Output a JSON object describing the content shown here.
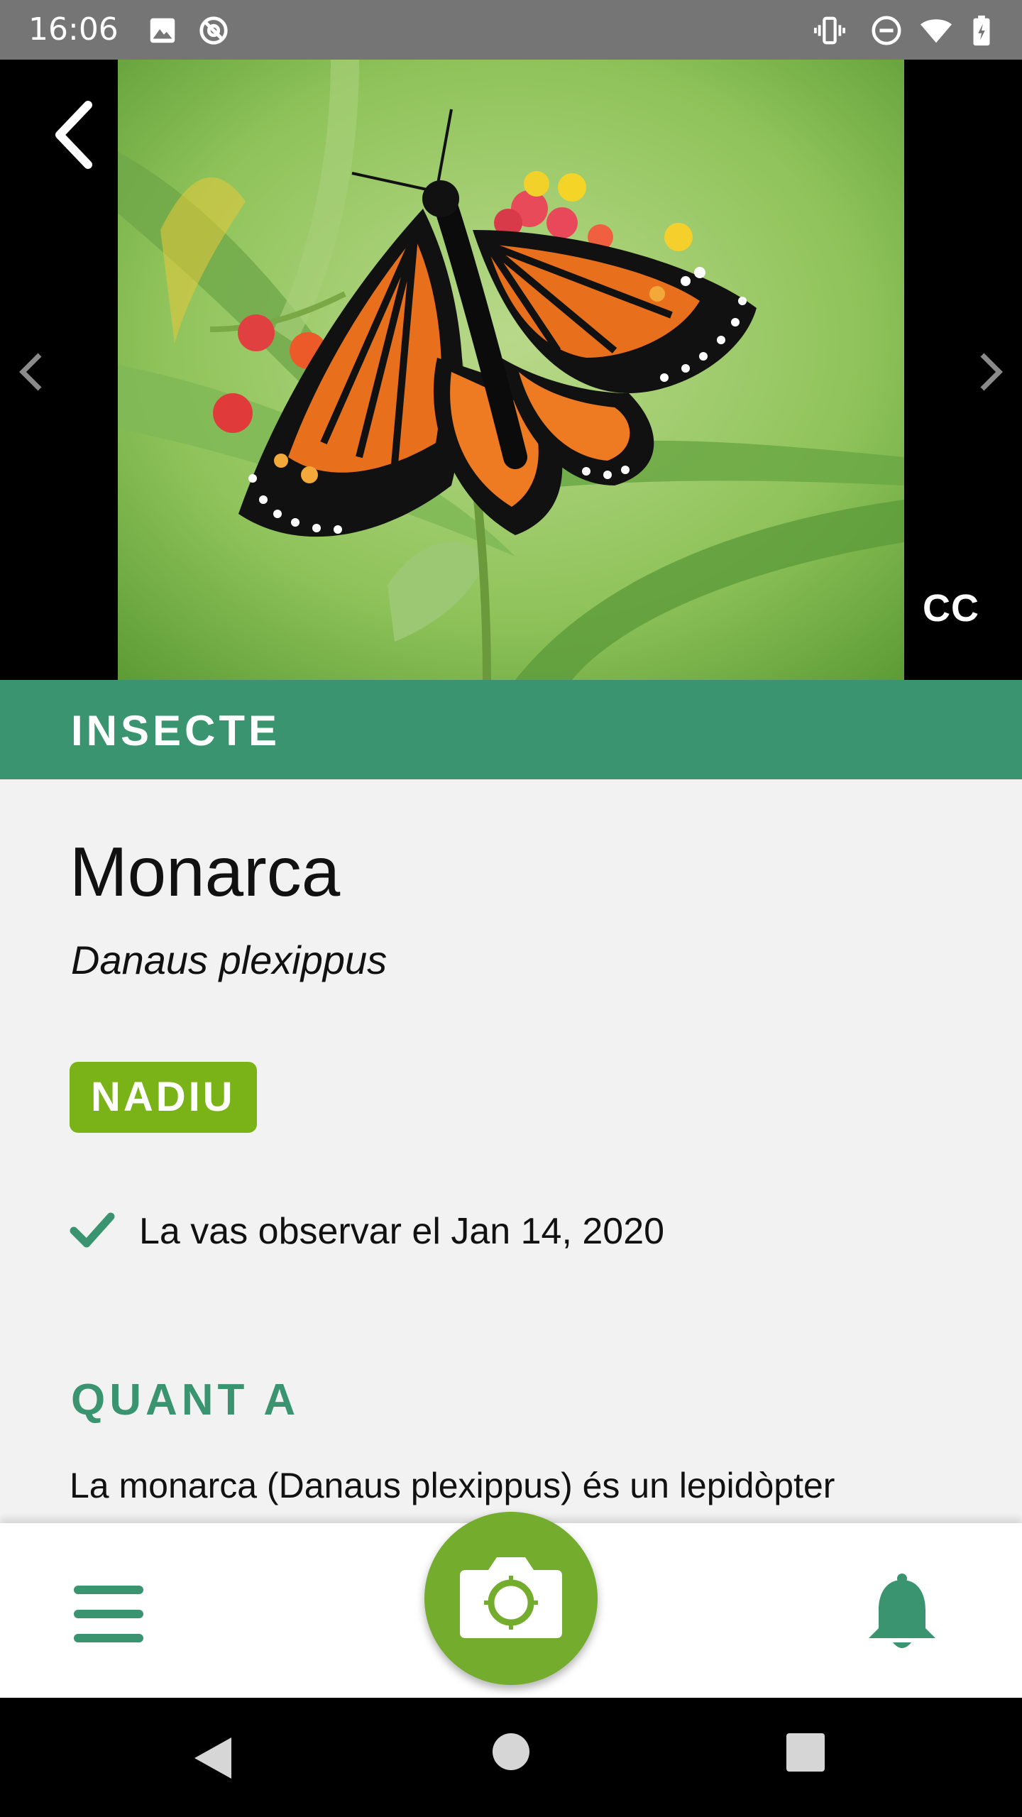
{
  "status_bar": {
    "time": "16:06",
    "left_icons": [
      "image-icon",
      "at-sign-icon"
    ],
    "right_icons": [
      "vibrate-icon",
      "do-not-disturb-icon",
      "wifi-icon",
      "battery-icon"
    ]
  },
  "hero": {
    "license_label": "CC",
    "icons": [
      "back-arrow-icon",
      "chevron-left-icon",
      "chevron-right-icon"
    ]
  },
  "species": {
    "category": "INSECTE",
    "common_name": "Monarca",
    "scientific_name": "Danaus plexippus",
    "status_badge": "NADIU",
    "observed_text": "La vas observar el Jan 14, 2020"
  },
  "about": {
    "heading": "QUANT A",
    "text": "La monarca (Danaus plexippus) és un lepidòpter"
  },
  "bottom_nav": {
    "icons": [
      "menu-icon",
      "camera-icon",
      "bell-icon"
    ]
  },
  "colors": {
    "accent_green": "#3a9470",
    "badge_green": "#7ab317",
    "camera_green": "#74ac2e",
    "status_bar_gray": "#757575"
  }
}
